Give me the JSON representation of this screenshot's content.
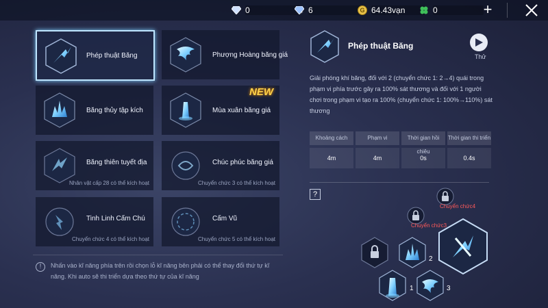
{
  "topbar": {
    "diamond_value": "0",
    "bound_diamond_value": "6",
    "gold_value": "64.43vạn",
    "clover_value": "0",
    "icons": [
      "diamond-icon",
      "bound-diamond-icon",
      "gold-coin-icon",
      "clover-icon",
      "plus-icon",
      "close-icon"
    ]
  },
  "skills": [
    {
      "name": "Phép thuật Băng",
      "requirement": ""
    },
    {
      "name": "Phượng Hoàng băng giá",
      "requirement": ""
    },
    {
      "name": "Băng thủy tập kích",
      "requirement": ""
    },
    {
      "name": "Mùa xuân băng giá",
      "requirement": ""
    },
    {
      "name": "Băng thiên tuyết địa",
      "requirement": "Nhân vật cấp 28 có thể kích hoạt"
    },
    {
      "name": "Chúc phúc băng giá",
      "requirement": "Chuyển chức 3 có thể kích hoạt"
    },
    {
      "name": "Tinh Linh Cấm Chú",
      "requirement": "Chuyển chức 4 có thể kích hoạt"
    },
    {
      "name": "Cấm Vũ",
      "requirement": "Chuyển chức 5 có thể kích hoạt"
    }
  ],
  "new_badge": "NEW",
  "hint": "Nhấn vào kĩ năng phía trên rồi chọn lỗ kĩ năng bên phải có thể thay đổi thứ tự kĩ năng. Khi auto sẽ thi triển dựa theo thứ tự của kĩ năng",
  "detail": {
    "title": "Phép thuật Băng",
    "try_label": "Thử",
    "description": "Giải phóng khí băng, đối với 2 (chuyển chức 1: 2→4) quái trong phạm vi phía trước gây ra 100% sát thương và đối với 1 người chơi trong phạm vi tạo ra 100% (chuyển chức 1: 100%→110%) sát thương",
    "stats": [
      {
        "label": "Khoảng cách",
        "value": "4m"
      },
      {
        "label": "Phạm vi",
        "value": "4m"
      },
      {
        "label": "Thời gian hồi chiêu",
        "value": "0s"
      },
      {
        "label": "Thời gian thi triển",
        "value": "0.4s"
      }
    ],
    "help": "?"
  },
  "slots": {
    "labels": [
      "1",
      "2",
      "3"
    ],
    "lock_labels": [
      "Chuyển chức4",
      "Chuyển chức3"
    ]
  },
  "colors": {
    "accent_glow": "#7fd0ff",
    "new_badge": "#ffd24a",
    "lock_label": "#ff5a5a"
  }
}
